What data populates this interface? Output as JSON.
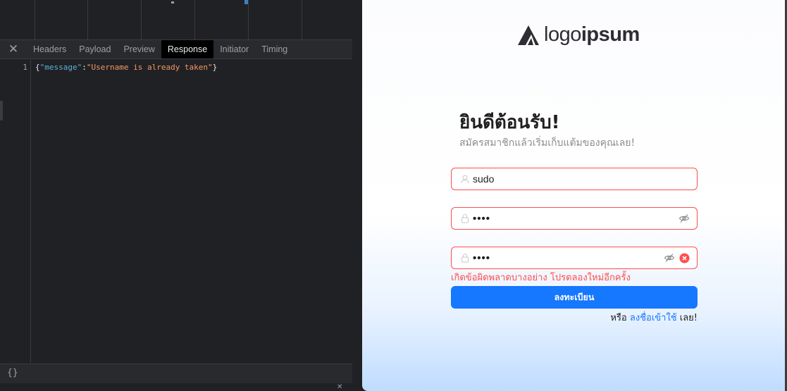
{
  "devtools": {
    "tabs": [
      "Headers",
      "Payload",
      "Preview",
      "Response",
      "Initiator",
      "Timing"
    ],
    "active_tab": "Response",
    "close_icon": "close-icon",
    "response": {
      "line_number": "1",
      "open": "{",
      "key": "\"message\"",
      "colon": ":",
      "value": "\"Username is already taken\"",
      "close": "}"
    },
    "pretty_print_label": "{}",
    "colors": {
      "key": "#5db0d7",
      "string": "#f29766",
      "active_tab_bg": "#000000"
    }
  },
  "page": {
    "logo": {
      "light": "logo",
      "bold": "ipsum",
      "icon": "mountain-logo-icon"
    },
    "title": "ยินดีต้อนรับ!",
    "subtitle": "สมัครสมาชิกแล้วเริ่มเก็บแต้มของคุณเลย!",
    "username": {
      "value": "sudo",
      "icon": "user-icon"
    },
    "password": {
      "value": "••••",
      "icon": "lock-icon",
      "toggle_icon": "eye-invisible-icon"
    },
    "confirm_password": {
      "value": "••••",
      "icon": "lock-icon",
      "toggle_icon": "eye-invisible-icon",
      "clear_icon": "close-circle-icon"
    },
    "error_message": "เกิดข้อผิดพลาดบางอย่าง โปรดลองใหม่อีกครั้ง",
    "submit_label": "ลงทะเบียน",
    "alt_prefix": "หรือ ",
    "alt_link": "ลงชื่อเข้าใช้",
    "alt_suffix": " เลย!",
    "colors": {
      "primary": "#1677ff",
      "error": "#ff4d4f",
      "title": "#1f1f1f"
    }
  }
}
